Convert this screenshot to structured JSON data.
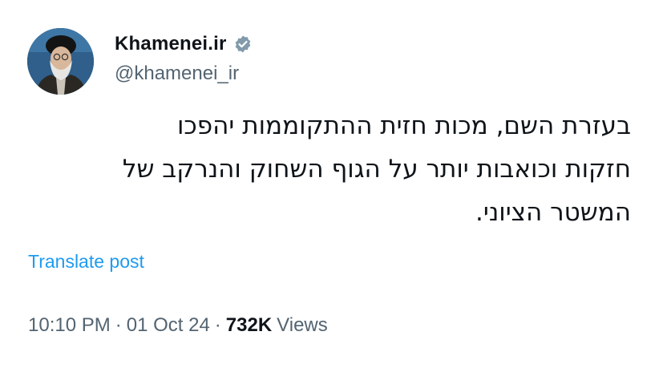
{
  "author": {
    "display_name": "Khamenei.ir",
    "handle": "@khamenei_ir",
    "verified": true,
    "verified_color": "#829aab",
    "avatar_icon": "portrait-avatar"
  },
  "tweet": {
    "lines": [
      "בעזרת השם, מכות חזית ההתקוממות יהפכו",
      "חזקות וכואבות יותר על הגוף השחוק והנרקב של",
      "המשטר הציוני."
    ]
  },
  "translate_label": "Translate post",
  "meta": {
    "time": "10:10 PM",
    "separator": "·",
    "date": "01 Oct 24",
    "views_count": "732K",
    "views_label": "Views"
  },
  "colors": {
    "text": "#0f1419",
    "secondary": "#536471",
    "link": "#1d9bf0"
  }
}
